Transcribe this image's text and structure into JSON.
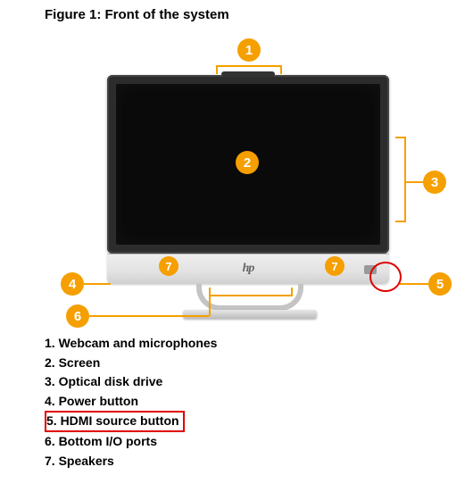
{
  "figure": {
    "title": "Figure 1: Front of the system",
    "logo_text": "hp"
  },
  "callouts": {
    "c1": "1",
    "c2": "2",
    "c3": "3",
    "c4": "4",
    "c5": "5",
    "c6": "6",
    "c7a": "7",
    "c7b": "7"
  },
  "legend": {
    "i1": "1. Webcam and microphones",
    "i2": "2. Screen",
    "i3": "3. Optical disk drive",
    "i4": "4. Power button",
    "i5": "5. HDMI source button",
    "i6": "6. Bottom I/O ports",
    "i7": "7. Speakers"
  }
}
